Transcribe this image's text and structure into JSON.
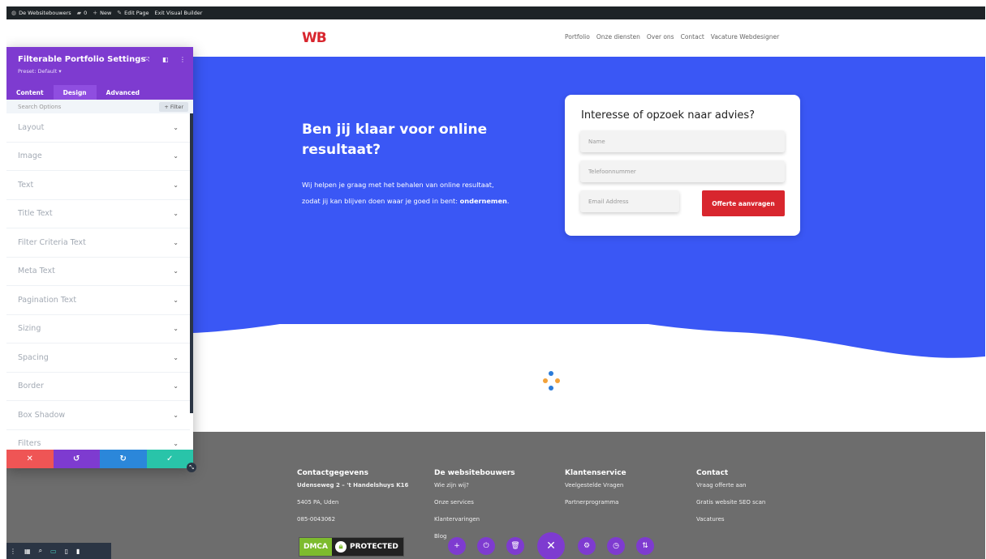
{
  "adminbar": {
    "site": "De Websitebouwers",
    "comments": "0",
    "new": "New",
    "edit": "Edit Page",
    "exit": "Exit Visual Builder"
  },
  "header": {
    "logo": "WB",
    "nav": [
      "Portfolio",
      "Onze diensten",
      "Over ons",
      "Contact",
      "Vacature Webdesigner"
    ]
  },
  "hero": {
    "title": "Ben jij klaar voor online resultaat?",
    "text_line1": "Wij helpen je graag met het behalen van online resultaat,",
    "text_line2_plain": "zodat jij kan blijven doen waar je goed in bent: ",
    "text_line2_bold": "ondernemen",
    "text_line2_end": "."
  },
  "form": {
    "title": "Interesse of opzoek naar advies?",
    "name_placeholder": "Name",
    "phone_placeholder": "Telefoonnummer",
    "email_placeholder": "Email Address",
    "submit": "Offerte aanvragen"
  },
  "footer": {
    "cols": [
      {
        "heading": "Contactgegevens",
        "links": [
          "Udenseweg 2 – 't Handelshuys K16",
          "5405 PA, Uden",
          "085-0043062"
        ]
      },
      {
        "heading": "De websitebouwers",
        "links": [
          "Wie zijn wij?",
          "Onze services",
          "Klantervaringen",
          "Blog"
        ]
      },
      {
        "heading": "Klantenservice",
        "links": [
          "Veelgestelde Vragen",
          "Partnerprogramma"
        ]
      },
      {
        "heading": "Contact",
        "links": [
          "Vraag offerte aan",
          "Gratis website SEO scan",
          "Vacatures"
        ]
      }
    ],
    "dmca_left": "DMCA",
    "dmca_right": "PROTECTED"
  },
  "panel": {
    "title": "Filterable Portfolio Settings",
    "preset": "Preset: Default ▾",
    "tabs": [
      "Content",
      "Design",
      "Advanced"
    ],
    "search_placeholder": "Search Options",
    "filter_label": "+ Filter",
    "options": [
      "Layout",
      "Image",
      "Text",
      "Title Text",
      "Filter Criteria Text",
      "Meta Text",
      "Pagination Text",
      "Sizing",
      "Spacing",
      "Border",
      "Box Shadow",
      "Filters"
    ]
  },
  "colors": {
    "hero_bg": "#3a57f5",
    "accent_purple": "#7e3bd0",
    "brand_red": "#d8262e",
    "footer_bg": "#6d6d6d"
  }
}
